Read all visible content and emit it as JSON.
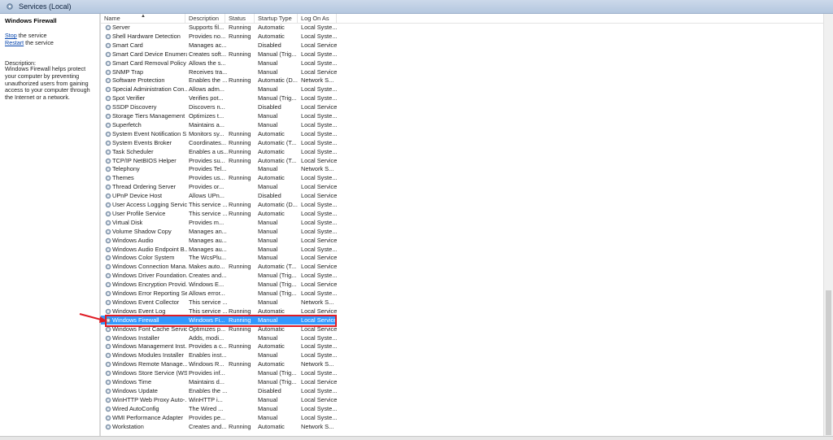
{
  "window": {
    "title": "Services (Local)"
  },
  "left_pane": {
    "service_title": "Windows Firewall",
    "stop_link": "Stop",
    "stop_suffix": " the service",
    "restart_link": "Restart",
    "restart_suffix": " the service",
    "description_label": "Description:",
    "description_text": "Windows Firewall helps protect your computer by preventing unauthorized users from gaining access to your computer through the Internet or a network."
  },
  "columns": [
    "Name",
    "Description",
    "Status",
    "Startup Type",
    "Log On As"
  ],
  "services": [
    [
      "Server",
      "Supports fil...",
      "Running",
      "Automatic",
      "Local Syste..."
    ],
    [
      "Shell Hardware Detection",
      "Provides no...",
      "Running",
      "Automatic",
      "Local Syste..."
    ],
    [
      "Smart Card",
      "Manages ac...",
      "",
      "Disabled",
      "Local Service"
    ],
    [
      "Smart Card Device Enumera...",
      "Creates soft...",
      "Running",
      "Manual (Trig...",
      "Local Syste..."
    ],
    [
      "Smart Card Removal Policy",
      "Allows the s...",
      "",
      "Manual",
      "Local Syste..."
    ],
    [
      "SNMP Trap",
      "Receives tra...",
      "",
      "Manual",
      "Local Service"
    ],
    [
      "Software Protection",
      "Enables the ...",
      "Running",
      "Automatic (D...",
      "Network S..."
    ],
    [
      "Special Administration Con...",
      "Allows adm...",
      "",
      "Manual",
      "Local Syste..."
    ],
    [
      "Spot Verifier",
      "Verifies pot...",
      "",
      "Manual (Trig...",
      "Local Syste..."
    ],
    [
      "SSDP Discovery",
      "Discovers n...",
      "",
      "Disabled",
      "Local Service"
    ],
    [
      "Storage Tiers Management",
      "Optimizes t...",
      "",
      "Manual",
      "Local Syste..."
    ],
    [
      "Superfetch",
      "Maintains a...",
      "",
      "Manual",
      "Local Syste..."
    ],
    [
      "System Event Notification S...",
      "Monitors sy...",
      "Running",
      "Automatic",
      "Local Syste..."
    ],
    [
      "System Events Broker",
      "Coordinates...",
      "Running",
      "Automatic (T...",
      "Local Syste..."
    ],
    [
      "Task Scheduler",
      "Enables a us...",
      "Running",
      "Automatic",
      "Local Syste..."
    ],
    [
      "TCP/IP NetBIOS Helper",
      "Provides su...",
      "Running",
      "Automatic (T...",
      "Local Service"
    ],
    [
      "Telephony",
      "Provides Tel...",
      "",
      "Manual",
      "Network S..."
    ],
    [
      "Themes",
      "Provides us...",
      "Running",
      "Automatic",
      "Local Syste..."
    ],
    [
      "Thread Ordering Server",
      "Provides or...",
      "",
      "Manual",
      "Local Service"
    ],
    [
      "UPnP Device Host",
      "Allows UPn...",
      "",
      "Disabled",
      "Local Service"
    ],
    [
      "User Access Logging Service",
      "This service ...",
      "Running",
      "Automatic (D...",
      "Local Syste..."
    ],
    [
      "User Profile Service",
      "This service ...",
      "Running",
      "Automatic",
      "Local Syste..."
    ],
    [
      "Virtual Disk",
      "Provides m...",
      "",
      "Manual",
      "Local Syste..."
    ],
    [
      "Volume Shadow Copy",
      "Manages an...",
      "",
      "Manual",
      "Local Syste..."
    ],
    [
      "Windows Audio",
      "Manages au...",
      "",
      "Manual",
      "Local Service"
    ],
    [
      "Windows Audio Endpoint B...",
      "Manages au...",
      "",
      "Manual",
      "Local Syste..."
    ],
    [
      "Windows Color System",
      "The WcsPlu...",
      "",
      "Manual",
      "Local Service"
    ],
    [
      "Windows Connection Mana...",
      "Makes auto...",
      "Running",
      "Automatic (T...",
      "Local Service"
    ],
    [
      "Windows Driver Foundation...",
      "Creates and...",
      "",
      "Manual (Trig...",
      "Local Syste..."
    ],
    [
      "Windows Encryption Provid...",
      "Windows E...",
      "",
      "Manual (Trig...",
      "Local Service"
    ],
    [
      "Windows Error Reporting Se...",
      "Allows error...",
      "",
      "Manual (Trig...",
      "Local Syste..."
    ],
    [
      "Windows Event Collector",
      "This service ...",
      "",
      "Manual",
      "Network S..."
    ],
    [
      "Windows Event Log",
      "This service ...",
      "Running",
      "Automatic",
      "Local Service"
    ],
    [
      "Windows Firewall",
      "Windows Fi...",
      "Running",
      "Manual",
      "Local Service"
    ],
    [
      "Windows Font Cache Service",
      "Optimizes p...",
      "Running",
      "Automatic",
      "Local Service"
    ],
    [
      "Windows Installer",
      "Adds, modi...",
      "",
      "Manual",
      "Local Syste..."
    ],
    [
      "Windows Management Inst...",
      "Provides a c...",
      "Running",
      "Automatic",
      "Local Syste..."
    ],
    [
      "Windows Modules Installer",
      "Enables inst...",
      "",
      "Manual",
      "Local Syste..."
    ],
    [
      "Windows Remote Manage...",
      "Windows R...",
      "Running",
      "Automatic",
      "Network S..."
    ],
    [
      "Windows Store Service (WS...",
      "Provides inf...",
      "",
      "Manual (Trig...",
      "Local Syste..."
    ],
    [
      "Windows Time",
      "Maintains d...",
      "",
      "Manual (Trig...",
      "Local Service"
    ],
    [
      "Windows Update",
      "Enables the ...",
      "",
      "Disabled",
      "Local Syste..."
    ],
    [
      "WinHTTP Web Proxy Auto-...",
      "WinHTTP i...",
      "",
      "Manual",
      "Local Service"
    ],
    [
      "Wired AutoConfig",
      "The Wired ...",
      "",
      "Manual",
      "Local Syste..."
    ],
    [
      "WMI Performance Adapter",
      "Provides pe...",
      "",
      "Manual",
      "Local Syste..."
    ],
    [
      "Workstation",
      "Creates and...",
      "Running",
      "Automatic",
      "Network S..."
    ]
  ],
  "selected_service": "Windows Firewall",
  "colors": {
    "selection": "#3399ff",
    "highlight_box": "#e01b24",
    "link": "#0645ad"
  }
}
